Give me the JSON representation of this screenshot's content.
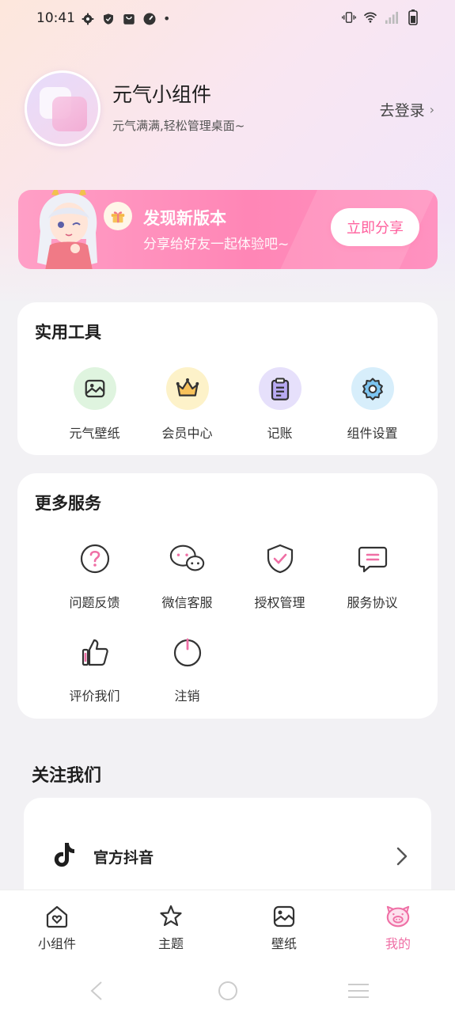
{
  "status_bar": {
    "time": "10:41",
    "dot": "•"
  },
  "profile": {
    "name": "元气小组件",
    "subtitle": "元气满满,轻松管理桌面~",
    "login_label": "去登录",
    "login_chevron": "›"
  },
  "banner": {
    "title": "发现新版本",
    "subtitle": "分享给好友一起体验吧~",
    "button_label": "立即分享"
  },
  "tools": {
    "title": "实用工具",
    "items": [
      {
        "label": "元气壁纸",
        "icon": "wallpaper-icon",
        "bg": "#dff4df"
      },
      {
        "label": "会员中心",
        "icon": "crown-icon",
        "bg": "#fdf2c9"
      },
      {
        "label": "记账",
        "icon": "clipboard-icon",
        "bg": "#e6e0fb"
      },
      {
        "label": "组件设置",
        "icon": "gear-icon",
        "bg": "#d7eefb"
      }
    ]
  },
  "services": {
    "title": "更多服务",
    "items": [
      {
        "label": "问题反馈",
        "icon": "question-icon"
      },
      {
        "label": "微信客服",
        "icon": "wechat-icon"
      },
      {
        "label": "授权管理",
        "icon": "shield-check-icon"
      },
      {
        "label": "服务协议",
        "icon": "agreement-icon"
      },
      {
        "label": "评价我们",
        "icon": "thumbs-up-icon"
      },
      {
        "label": "注销",
        "icon": "power-icon"
      }
    ]
  },
  "follow": {
    "title": "关注我们",
    "items": [
      {
        "label": "官方抖音",
        "icon": "douyin-icon"
      }
    ]
  },
  "bottom_nav": {
    "items": [
      {
        "label": "小组件",
        "icon": "home-heart-icon",
        "active": false
      },
      {
        "label": "主题",
        "icon": "star-icon",
        "active": false
      },
      {
        "label": "壁纸",
        "icon": "picture-icon",
        "active": false
      },
      {
        "label": "我的",
        "icon": "pig-face-icon",
        "active": true
      }
    ]
  },
  "colors": {
    "accent": "#ef6fa5",
    "banner": "#ff86b6",
    "background": "#f2f1f4"
  }
}
